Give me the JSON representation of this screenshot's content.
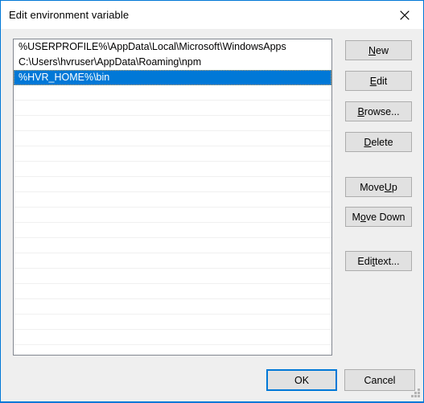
{
  "window": {
    "title": "Edit environment variable",
    "close_icon": "close-icon",
    "accent_color": "#0078d7",
    "background_color": "#efefef",
    "titlebar_color": "#ffffff"
  },
  "list": {
    "selected_index": 2,
    "total_rows": 20,
    "selection_color": "#0078d7",
    "items": [
      "%USERPROFILE%\\AppData\\Local\\Microsoft\\WindowsApps",
      "C:\\Users\\hvruser\\AppData\\Roaming\\npm",
      "%HVR_HOME%\\bin"
    ]
  },
  "side_buttons": [
    {
      "id": "new",
      "label": "New",
      "accel": "N"
    },
    {
      "id": "edit",
      "label": "Edit",
      "accel": "E"
    },
    {
      "id": "browse",
      "label": "Browse...",
      "accel": "B"
    },
    {
      "id": "delete",
      "label": "Delete",
      "accel": "D"
    },
    {
      "id": "move_up",
      "label": "Move Up",
      "accel": "U"
    },
    {
      "id": "move_down",
      "label": "Move Down",
      "accel": "o"
    },
    {
      "id": "edit_text",
      "label": "Edit text...",
      "accel": "t"
    }
  ],
  "footer": {
    "ok_label": "OK",
    "cancel_label": "Cancel",
    "default_button": "OK"
  }
}
